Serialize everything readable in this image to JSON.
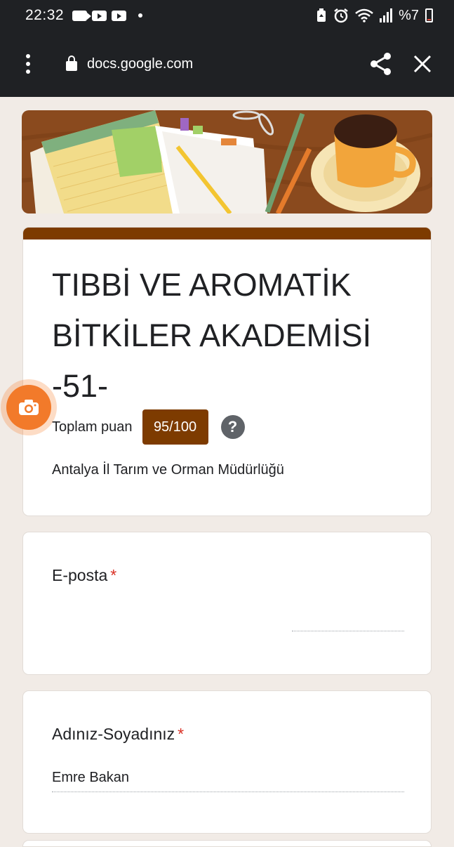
{
  "status_bar": {
    "time": "22:32",
    "battery": "%7",
    "icons": [
      "video-recorder-icon",
      "youtube-icon",
      "youtube-icon",
      "dot-icon",
      "battery-saver-icon",
      "alarm-icon",
      "wifi-icon",
      "signal-icon",
      "battery-icon"
    ]
  },
  "browser": {
    "url": "docs.google.com",
    "icons": [
      "more-vert-icon",
      "lock-icon",
      "share-icon",
      "close-icon"
    ]
  },
  "form": {
    "title": "TIBBİ VE AROMATİK BİTKİLER AKADEMİSİ -51-",
    "score_label": "Toplam puan",
    "score_value": "95/100",
    "description": "Antalya İl Tarım ve Orman Müdürlüğü",
    "accent_color": "#7d3b00",
    "questions": [
      {
        "label": "E-posta",
        "required_mark": "*",
        "value": ""
      },
      {
        "label": "Adınız-Soyadınız",
        "required_mark": "*",
        "value": "Emre Bakan"
      }
    ]
  },
  "floating_button": {
    "icon": "camera-icon",
    "color": "#f27a2a"
  }
}
